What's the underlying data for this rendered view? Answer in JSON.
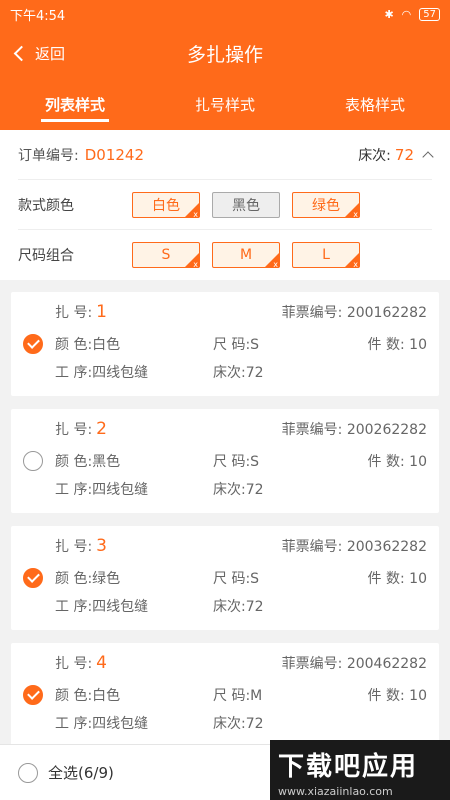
{
  "status_bar": {
    "time": "下午4:54",
    "battery": "57"
  },
  "nav": {
    "back_label": "返回",
    "title": "多扎操作"
  },
  "tabs": [
    {
      "label": "列表样式",
      "active": true
    },
    {
      "label": "扎号样式",
      "active": false
    },
    {
      "label": "表格样式",
      "active": false
    }
  ],
  "filter": {
    "order_label": "订单编号:",
    "order_value": "D01242",
    "bed_label": "床次:",
    "bed_value": "72",
    "color_label": "款式颜色",
    "colors": [
      {
        "label": "白色",
        "selected": true
      },
      {
        "label": "黑色",
        "selected": false
      },
      {
        "label": "绿色",
        "selected": true
      }
    ],
    "size_label": "尺码组合",
    "sizes": [
      {
        "label": "S",
        "selected": true
      },
      {
        "label": "M",
        "selected": true
      },
      {
        "label": "L",
        "selected": true
      }
    ]
  },
  "field_labels": {
    "bundle": "扎 号:",
    "ticket": "菲票编号:",
    "color": "颜 色:",
    "size": "尺 码:",
    "qty": "件 数:",
    "process": "工 序:",
    "bed": "床次:"
  },
  "bundles": [
    {
      "no": "1",
      "ticket": "200162282",
      "color": "白色",
      "size": "S",
      "qty": "10",
      "process": "四线包缝",
      "bed": "72",
      "checked": true
    },
    {
      "no": "2",
      "ticket": "200262282",
      "color": "黑色",
      "size": "S",
      "qty": "10",
      "process": "四线包缝",
      "bed": "72",
      "checked": false
    },
    {
      "no": "3",
      "ticket": "200362282",
      "color": "绿色",
      "size": "S",
      "qty": "10",
      "process": "四线包缝",
      "bed": "72",
      "checked": true
    },
    {
      "no": "4",
      "ticket": "200462282",
      "color": "白色",
      "size": "M",
      "qty": "10",
      "process": "四线包缝",
      "bed": "72",
      "checked": true
    }
  ],
  "bottom": {
    "select_all": "全选(6/9)"
  },
  "watermark": {
    "title": "下载吧应用",
    "url": "www.xiazaiinlao.com"
  },
  "colors": {
    "accent": "#ff6a1a"
  }
}
